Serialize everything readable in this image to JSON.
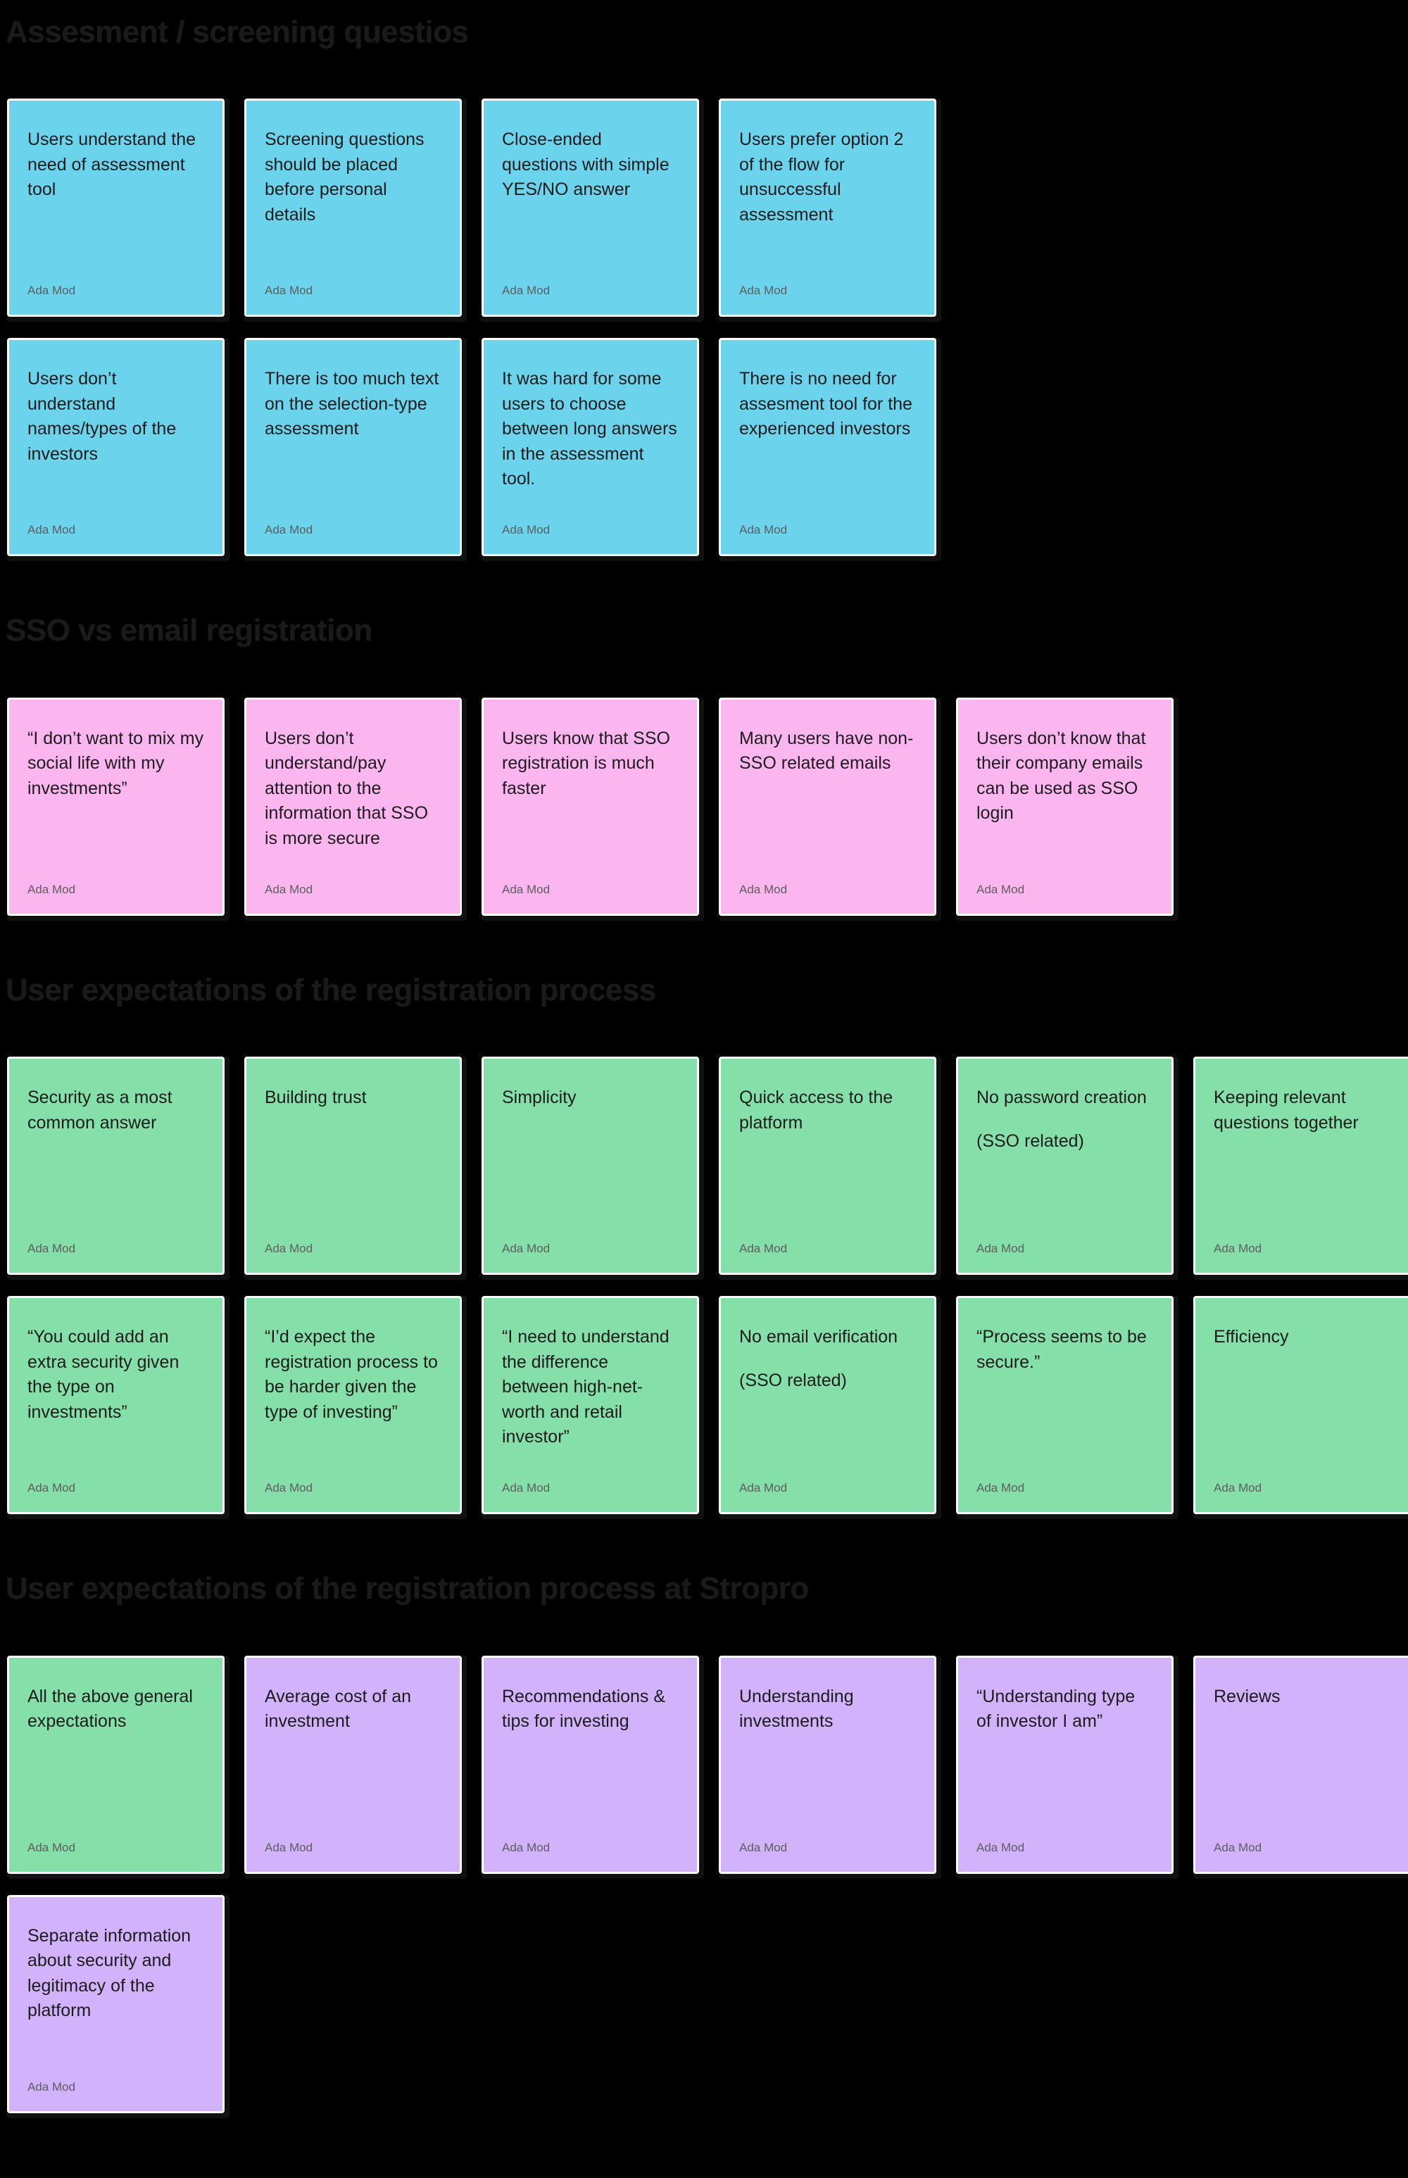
{
  "colors": {
    "background": "#000000",
    "heading": "#1a1a1a",
    "blue": "#6bd3ec",
    "pink": "#fbb6f0",
    "green": "#85dfa9",
    "purple": "#d2b2fb",
    "card_text": "#1c1c1c",
    "author_text": "#5e5e5e",
    "card_border": "#ffffff",
    "card_shadow": "#111111"
  },
  "author_label": "Ada Mod",
  "sections": [
    {
      "id": "assessment-screening-questions",
      "heading": "Assesment / screening questios",
      "rows": [
        {
          "cards": [
            {
              "color": "blue",
              "lines": [
                "Users understand the need of assessment tool"
              ],
              "author": "Ada Mod"
            },
            {
              "color": "blue",
              "lines": [
                "Screening questions should be placed before personal details"
              ],
              "author": "Ada Mod"
            },
            {
              "color": "blue",
              "lines": [
                "Close-ended questions with simple YES/NO answer"
              ],
              "author": "Ada Mod"
            },
            {
              "color": "blue",
              "lines": [
                "Users prefer option 2 of the flow for unsuccessful assessment"
              ],
              "author": "Ada Mod"
            }
          ]
        },
        {
          "cards": [
            {
              "color": "blue",
              "lines": [
                "Users don’t understand names/types of the investors"
              ],
              "author": "Ada Mod"
            },
            {
              "color": "blue",
              "lines": [
                "There is too much text on the selection-type assessment"
              ],
              "author": "Ada Mod"
            },
            {
              "color": "blue",
              "lines": [
                "It was hard for some users to choose between long answers in the assessment tool."
              ],
              "author": "Ada Mod"
            },
            {
              "color": "blue",
              "lines": [
                "There is no need for assesment tool for the experienced investors"
              ],
              "author": "Ada Mod"
            }
          ]
        }
      ]
    },
    {
      "id": "sso-vs-email-registration",
      "heading": "SSO vs email registration",
      "rows": [
        {
          "cards": [
            {
              "color": "pink",
              "lines": [
                "“I don’t want to mix my social life with my investments”"
              ],
              "author": "Ada Mod"
            },
            {
              "color": "pink",
              "lines": [
                "Users don’t understand/pay attention to the information that SSO is more secure"
              ],
              "author": "Ada Mod"
            },
            {
              "color": "pink",
              "lines": [
                "Users know that SSO registration is much faster"
              ],
              "author": "Ada Mod"
            },
            {
              "color": "pink",
              "lines": [
                "Many users have non-SSO related emails"
              ],
              "author": "Ada Mod"
            },
            {
              "color": "pink",
              "lines": [
                "Users don’t know that their company emails can be used as SSO login"
              ],
              "author": "Ada Mod"
            }
          ]
        }
      ]
    },
    {
      "id": "user-expectations-registration-process",
      "heading": "User expectations of the registration process",
      "rows": [
        {
          "cards": [
            {
              "color": "green",
              "lines": [
                "Security as a most common answer"
              ],
              "author": "Ada Mod"
            },
            {
              "color": "green",
              "lines": [
                "Building trust"
              ],
              "author": "Ada Mod"
            },
            {
              "color": "green",
              "lines": [
                "Simplicity"
              ],
              "author": "Ada Mod"
            },
            {
              "color": "green",
              "lines": [
                "Quick access to the platform"
              ],
              "author": "Ada Mod"
            },
            {
              "color": "green",
              "lines": [
                "No password creation",
                "(SSO related)"
              ],
              "author": "Ada Mod"
            },
            {
              "color": "green",
              "lines": [
                "Keeping relevant questions together"
              ],
              "author": "Ada Mod"
            }
          ]
        },
        {
          "cards": [
            {
              "color": "green",
              "lines": [
                "“You could add an extra security given the type on investments”"
              ],
              "author": "Ada Mod"
            },
            {
              "color": "green",
              "lines": [
                "“I’d expect the registration process to be harder given the type of investing”"
              ],
              "author": "Ada Mod"
            },
            {
              "color": "green",
              "lines": [
                "“I need to understand the difference between high-net-worth and retail investor”"
              ],
              "author": "Ada Mod"
            },
            {
              "color": "green",
              "lines": [
                "No email verification",
                "(SSO related)"
              ],
              "author": "Ada Mod"
            },
            {
              "color": "green",
              "lines": [
                "“Process seems to be secure.”"
              ],
              "author": "Ada Mod"
            },
            {
              "color": "green",
              "lines": [
                "Efficiency"
              ],
              "author": "Ada Mod"
            }
          ]
        }
      ]
    },
    {
      "id": "user-expectations-registration-process-stropro",
      "heading": "User expectations of the registration process at Stropro",
      "rows": [
        {
          "cards": [
            {
              "color": "green",
              "lines": [
                "All the above general expectations"
              ],
              "author": "Ada Mod"
            },
            {
              "color": "purple",
              "lines": [
                "Average cost of an investment"
              ],
              "author": "Ada Mod"
            },
            {
              "color": "purple",
              "lines": [
                "Recommendations & tips for investing"
              ],
              "author": "Ada Mod"
            },
            {
              "color": "purple",
              "lines": [
                "Understanding investments"
              ],
              "author": "Ada Mod"
            },
            {
              "color": "purple",
              "lines": [
                "“Understanding type of investor I am”"
              ],
              "author": "Ada Mod"
            },
            {
              "color": "purple",
              "lines": [
                "Reviews"
              ],
              "author": "Ada Mod"
            }
          ]
        },
        {
          "cards": [
            {
              "color": "purple",
              "lines": [
                "Separate information about security and legitimacy of the platform"
              ],
              "author": "Ada Mod"
            }
          ]
        }
      ]
    }
  ]
}
